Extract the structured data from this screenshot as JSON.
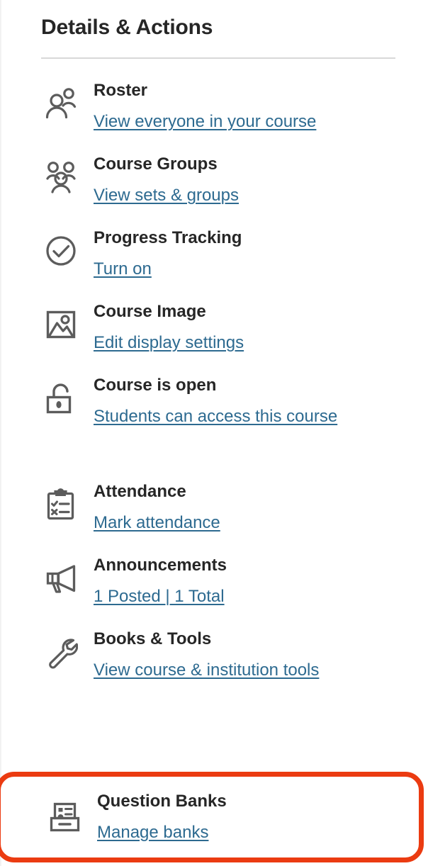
{
  "panel": {
    "title": "Details & Actions"
  },
  "items": [
    {
      "icon": "roster-people-icon",
      "name": "roster",
      "title": "Roster",
      "link": "View everyone in your course",
      "two_line": false,
      "highlighted": false
    },
    {
      "icon": "course-groups-people-icon",
      "name": "course-groups",
      "title": "Course Groups",
      "link": "View sets & groups",
      "two_line": false,
      "highlighted": false
    },
    {
      "icon": "check-circle-icon",
      "name": "progress-tracking",
      "title": "Progress Tracking",
      "link": "Turn on",
      "two_line": false,
      "highlighted": false
    },
    {
      "icon": "image-picture-icon",
      "name": "course-image",
      "title": "Course Image",
      "link": "Edit display settings",
      "two_line": false,
      "highlighted": false
    },
    {
      "icon": "unlock-open-padlock-icon",
      "name": "course-is-open",
      "title": "Course is open",
      "link": "Students can access this course",
      "two_line": true,
      "highlighted": false
    },
    {
      "icon": "clipboard-checklist-icon",
      "name": "attendance",
      "title": "Attendance",
      "link": "Mark attendance",
      "two_line": false,
      "highlighted": false
    },
    {
      "icon": "megaphone-icon",
      "name": "announcements",
      "title": "Announcements",
      "link": "1 Posted | 1 Total",
      "two_line": false,
      "highlighted": false
    },
    {
      "icon": "wrench-icon",
      "name": "books-and-tools",
      "title": "Books & Tools",
      "link": "View course & institution tools",
      "two_line": true,
      "highlighted": false
    },
    {
      "icon": "question-banks-drawer-icon",
      "name": "question-banks",
      "title": "Question Banks",
      "link": "Manage banks",
      "two_line": false,
      "highlighted": true
    }
  ],
  "colors": {
    "link": "#2d6a90",
    "title_text": "#262626",
    "icon": "#5c5c5c",
    "highlight_outline": "#eb3b11",
    "divider": "#d8d8d8",
    "background": "#ffffff"
  }
}
